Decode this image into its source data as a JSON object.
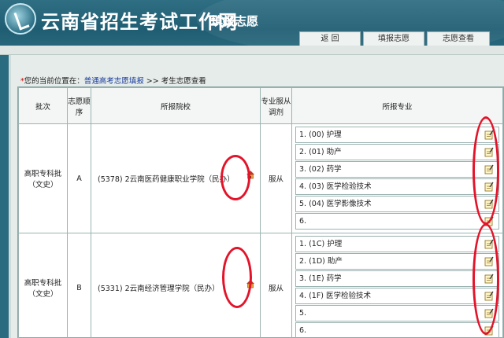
{
  "header": {
    "site_title": "云南省招生考试工作网",
    "sub_title": "填报志愿"
  },
  "tabs": [
    {
      "label": "返  回"
    },
    {
      "label": "填报志愿"
    },
    {
      "label": "志愿查看"
    }
  ],
  "breadcrumb": {
    "star": "*",
    "prefix": "您的当前位置在：",
    "link": "普通高考志愿填报",
    "sep": " >> ",
    "current": "考生志愿查看"
  },
  "table": {
    "headers": {
      "batch": "批次",
      "order": "志愿顺序",
      "school": "所报院校",
      "obey": "专业服从调剂",
      "majors": "所报专业"
    },
    "rows": [
      {
        "batch": "高职专科批（文史）",
        "order": "A",
        "school": "(5378) 2云南医药健康职业学院（民办）",
        "obey": "服从",
        "majors": [
          "1. (00) 护理",
          "2. (01) 助产",
          "3. (02) 药学",
          "4. (03) 医学检验技术",
          "5. (04) 医学影像技术",
          "6."
        ]
      },
      {
        "batch": "高职专科批（文史）",
        "order": "B",
        "school": "(5331) 2云南经济管理学院（民办）",
        "obey": "服从",
        "majors": [
          "1. (1C) 护理",
          "2. (1D) 助产",
          "3. (1E) 药学",
          "4. (1F) 医学检验技术",
          "5.",
          "6."
        ]
      }
    ]
  },
  "colors": {
    "header": "#1f5d73",
    "annotation": "#e3142a",
    "link": "#1a3c9e"
  }
}
